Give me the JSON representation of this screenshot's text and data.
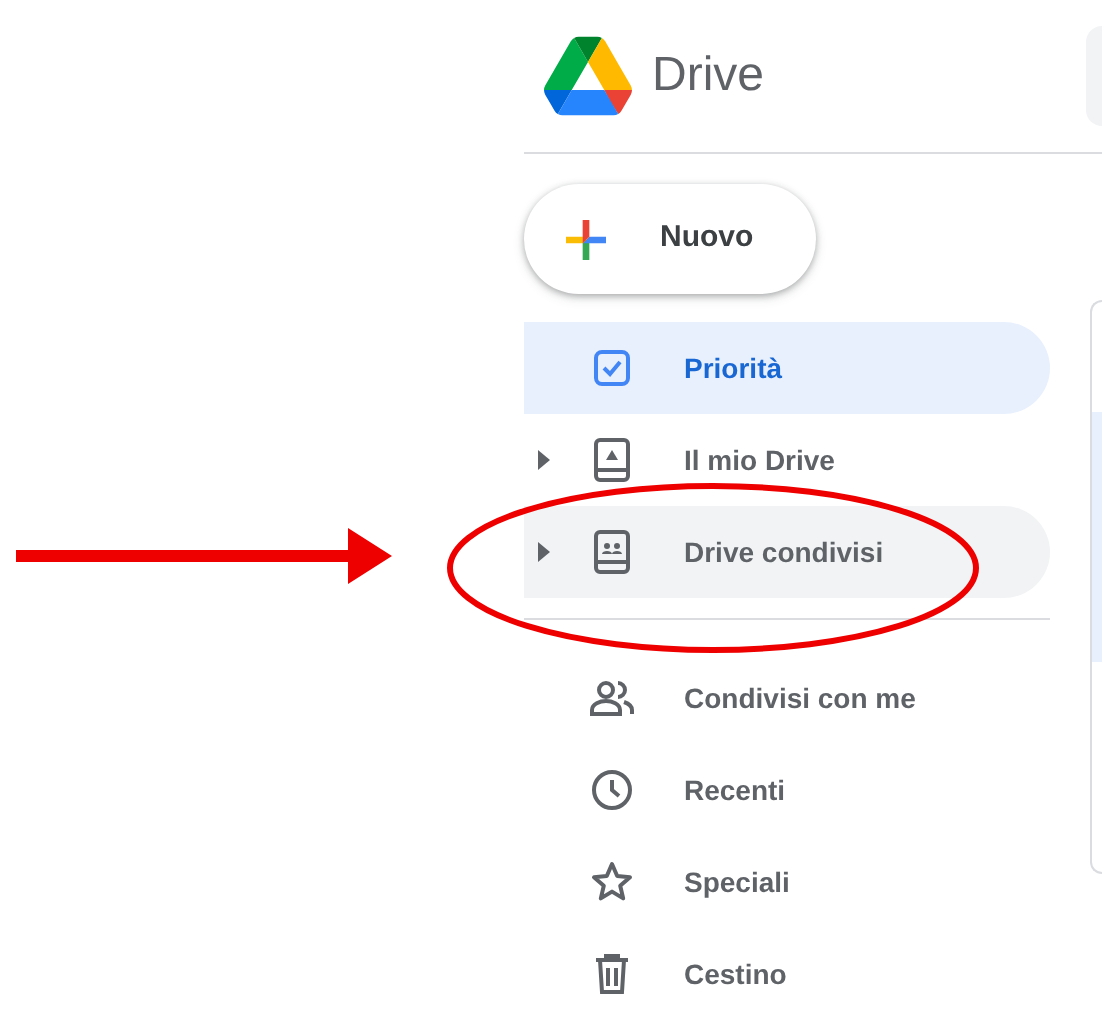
{
  "app": {
    "title": "Drive"
  },
  "new_button": {
    "label": "Nuovo"
  },
  "nav": [
    {
      "label": "Priorità",
      "selected": true,
      "hovered": false,
      "has_children": false
    },
    {
      "label": "Il mio Drive",
      "selected": false,
      "hovered": false,
      "has_children": true
    },
    {
      "label": "Drive condivisi",
      "selected": false,
      "hovered": true,
      "has_children": true
    },
    {
      "label": "Condivisi con me",
      "selected": false,
      "hovered": false,
      "has_children": false
    },
    {
      "label": "Recenti",
      "selected": false,
      "hovered": false,
      "has_children": false
    },
    {
      "label": "Speciali",
      "selected": false,
      "hovered": false,
      "has_children": false
    },
    {
      "label": "Cestino",
      "selected": false,
      "hovered": false,
      "has_children": false
    }
  ]
}
